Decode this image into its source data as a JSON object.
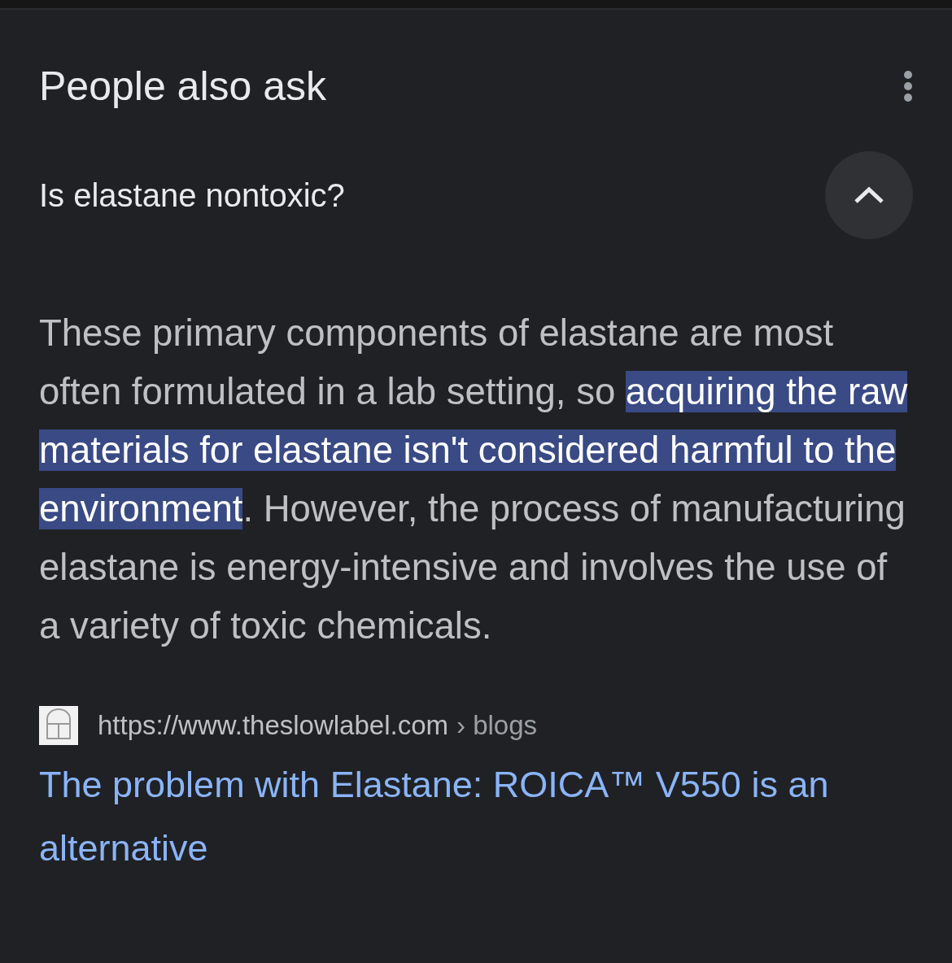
{
  "heading": "People also ask",
  "question": {
    "text": "Is elastane nontoxic?",
    "expanded": true
  },
  "answer": [
    {
      "text": "These primary components of elastane are most often formulated in a lab setting, so ",
      "highlighted": false
    },
    {
      "text": "acquiring the raw materials for elastane isn't considered harmful to the environment",
      "highlighted": true
    },
    {
      "text": ". However, the process of manufacturing elastane is energy-intensive and involves the use of a variety of toxic chemicals.",
      "highlighted": false
    }
  ],
  "source": {
    "url": "https://www.theslowlabel.com",
    "breadcrumb": "› blogs",
    "title": "The problem with Elastane: ROICA™ V550 is an alternative"
  }
}
